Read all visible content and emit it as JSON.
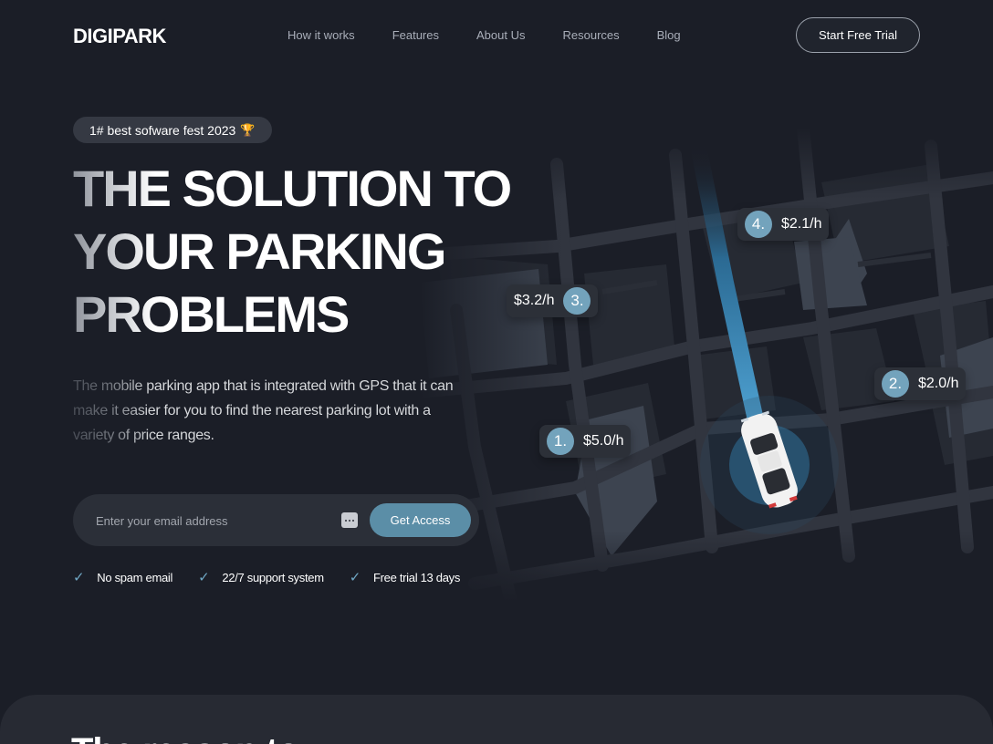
{
  "brand": {
    "logo": "DIGIPARK"
  },
  "nav": {
    "links": [
      "How it works",
      "Features",
      "About Us",
      "Resources",
      "Blog"
    ],
    "cta": "Start Free Trial"
  },
  "hero": {
    "badge_text": "1# best sofware fest 2023",
    "badge_icon": "trophy-icon",
    "title_lines": [
      "THE SOLUTION TO",
      "YOUR PARKING",
      "PROBLEMS"
    ],
    "description": "The mobile parking app that is integrated with GPS that it can make it easier for you to find the nearest parking lot with a variety of price ranges.",
    "email_placeholder": "Enter your email address",
    "submit_label": "Get Access",
    "perks": [
      "No spam email",
      "22/7 support system",
      "Free trial 13 days"
    ]
  },
  "map": {
    "prices": [
      {
        "num": "1.",
        "price": "$5.0/h"
      },
      {
        "num": "2.",
        "price": "$2.0/h"
      },
      {
        "num": "3.",
        "price": "$3.2/h"
      },
      {
        "num": "4.",
        "price": "$2.1/h"
      }
    ]
  },
  "next_section": {
    "heading": "The reason to"
  },
  "colors": {
    "background": "#1b1e27",
    "accent": "#5b8ea7",
    "pill": "#2c3038"
  }
}
